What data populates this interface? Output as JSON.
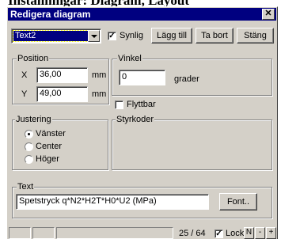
{
  "background_header": "Inställningar: Diagram, Layout",
  "window": {
    "title": "Redigera diagram",
    "close_glyph": "✕"
  },
  "toolbar": {
    "text_select": "Text2",
    "visible_label": "Synlig",
    "visible_checked": true,
    "add_label": "Lägg till",
    "delete_label": "Ta bort",
    "close_label": "Stäng"
  },
  "position": {
    "legend": "Position",
    "x_label": "X",
    "x_value": "36,00",
    "x_unit": "mm",
    "y_label": "Y",
    "y_value": "49,00",
    "y_unit": "mm"
  },
  "angle": {
    "legend": "Vinkel",
    "value": "0",
    "unit": "grader"
  },
  "movable": {
    "label": "Flyttbar",
    "checked": false
  },
  "alignment": {
    "legend": "Justering",
    "options": [
      "Vänster",
      "Center",
      "Höger"
    ],
    "selected": "Vänster"
  },
  "control_codes": {
    "legend": "Styrkoder"
  },
  "text_group": {
    "legend": "Text",
    "value": "Spetstryck q*N2*H2T*H0*U2  (MPa)",
    "font_button": "Font.."
  },
  "statusbar": {
    "counter": "25 / 64",
    "lock_label": "Lock",
    "lock_checked": true,
    "n_label": "N",
    "minus_label": "-",
    "plus_label": "+"
  },
  "colors": {
    "titlebar": "#000080",
    "face": "#d4d0c8"
  }
}
